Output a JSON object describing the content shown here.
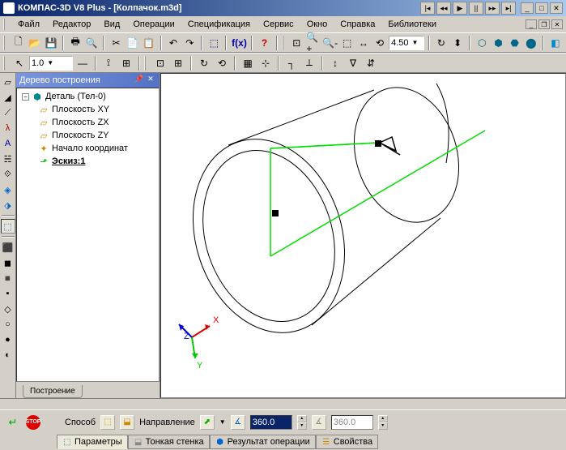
{
  "title": {
    "app": "КОМПАС-3D V8 Plus",
    "doc": " - [Колпачок.m3d]"
  },
  "menu": {
    "file": "Файл",
    "editor": "Редактор",
    "view": "Вид",
    "operations": "Операции",
    "spec": "Спецификация",
    "service": "Сервис",
    "window": "Окно",
    "help": "Справка",
    "libs": "Библиотеки"
  },
  "toolbar2": {
    "scale": "1.0",
    "value": "4.50"
  },
  "tree": {
    "title": "Дерево построения",
    "root": "Деталь (Тел-0)",
    "items": [
      "Плоскость XY",
      "Плоскость ZX",
      "Плоскость ZY",
      "Начало координат",
      "Эскиз:1"
    ],
    "tab": "Построение"
  },
  "axes": {
    "x": "X",
    "y": "Y",
    "z": "Z"
  },
  "prop": {
    "sposob": "Способ",
    "direction": "Направление",
    "val1": "360.0",
    "val2": "360.0"
  },
  "tabs": {
    "params": "Параметры",
    "thin": "Тонкая стенка",
    "result": "Результат операции",
    "props": "Свойства"
  }
}
